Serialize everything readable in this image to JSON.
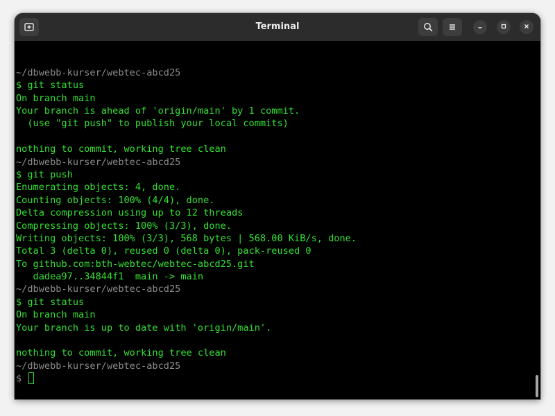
{
  "window": {
    "title": "Terminal"
  },
  "titlebar": {
    "new_tab_icon": "new-tab-icon",
    "search_icon": "search-icon",
    "menu_icon": "hamburger-menu-icon",
    "minimize_icon": "minimize-icon",
    "maximize_icon": "maximize-icon",
    "close_icon": "close-icon"
  },
  "colors": {
    "output_green": "#33e032",
    "path_gray": "#8c8c8c",
    "background": "#000000",
    "titlebar": "#2c2c2c"
  },
  "terminal": {
    "lines": [
      {
        "text": "~/dbwebb-kurser/webtec-abcd25",
        "style": "path"
      },
      {
        "text": "$ git status",
        "style": "green"
      },
      {
        "text": "On branch main",
        "style": "green"
      },
      {
        "text": "Your branch is ahead of 'origin/main' by 1 commit.",
        "style": "green"
      },
      {
        "text": "  (use \"git push\" to publish your local commits)",
        "style": "green"
      },
      {
        "text": "",
        "style": "green"
      },
      {
        "text": "nothing to commit, working tree clean",
        "style": "green"
      },
      {
        "text": "~/dbwebb-kurser/webtec-abcd25",
        "style": "path"
      },
      {
        "text": "$ git push",
        "style": "green"
      },
      {
        "text": "Enumerating objects: 4, done.",
        "style": "green"
      },
      {
        "text": "Counting objects: 100% (4/4), done.",
        "style": "green"
      },
      {
        "text": "Delta compression using up to 12 threads",
        "style": "green"
      },
      {
        "text": "Compressing objects: 100% (3/3), done.",
        "style": "green"
      },
      {
        "text": "Writing objects: 100% (3/3), 568 bytes | 568.00 KiB/s, done.",
        "style": "green"
      },
      {
        "text": "Total 3 (delta 0), reused 0 (delta 0), pack-reused 0",
        "style": "green"
      },
      {
        "text": "To github.com:bth-webtec/webtec-abcd25.git",
        "style": "green"
      },
      {
        "text": "   dadea97..34844f1  main -> main",
        "style": "green"
      },
      {
        "text": "~/dbwebb-kurser/webtec-abcd25",
        "style": "path"
      },
      {
        "text": "$ git status",
        "style": "green"
      },
      {
        "text": "On branch main",
        "style": "green"
      },
      {
        "text": "Your branch is up to date with 'origin/main'.",
        "style": "green"
      },
      {
        "text": "",
        "style": "green"
      },
      {
        "text": "nothing to commit, working tree clean",
        "style": "green"
      },
      {
        "text": "~/dbwebb-kurser/webtec-abcd25",
        "style": "path"
      }
    ],
    "prompt": "$ "
  }
}
